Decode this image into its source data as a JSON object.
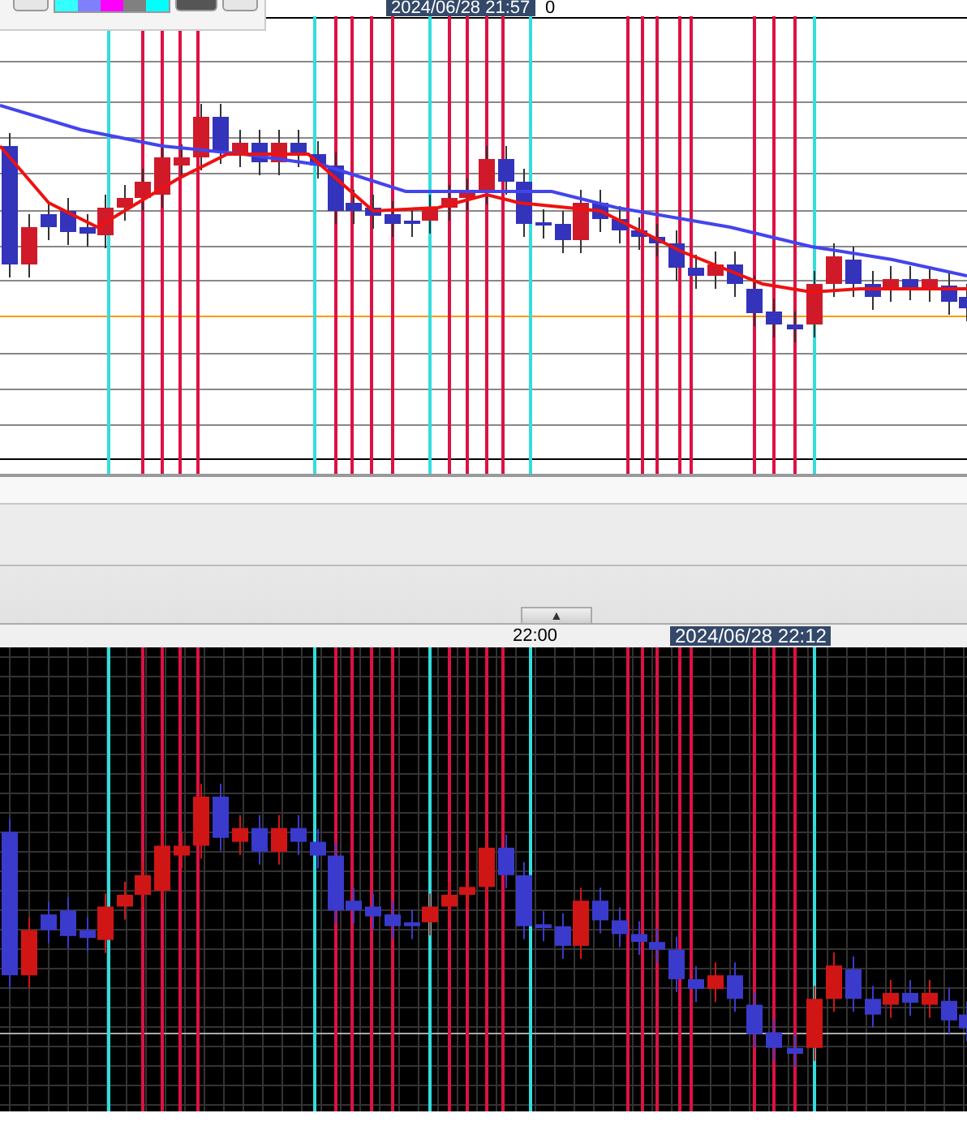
{
  "toolbar": {
    "swatches": [
      {
        "color": "#33ffff"
      },
      {
        "color": "#8080ff"
      },
      {
        "color": "#ff00ff"
      },
      {
        "color": "#808080"
      },
      {
        "color": "#00ffff"
      }
    ]
  },
  "top_chart": {
    "cursor_time": "2024/06/28 21:57",
    "edge_label": "0"
  },
  "splitter": {
    "button": "▲"
  },
  "bottom_chart": {
    "axis_label": "22:00",
    "cursor_time": "2024/06/28 22:12"
  }
}
